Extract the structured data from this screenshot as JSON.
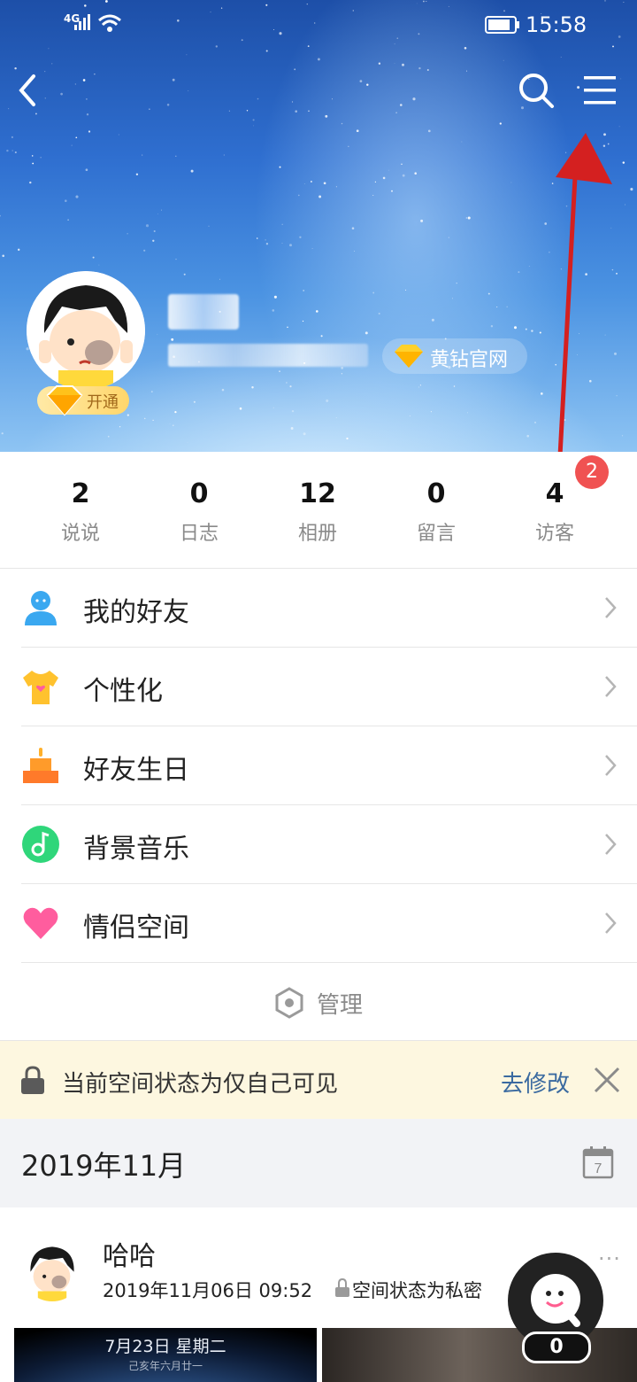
{
  "status_bar": {
    "network": "4G",
    "time": "15:58"
  },
  "profile": {
    "vip_badge": "开通",
    "yellow_diamond": "黄钻官网"
  },
  "stats": [
    {
      "value": "2",
      "label": "说说"
    },
    {
      "value": "0",
      "label": "日志"
    },
    {
      "value": "12",
      "label": "相册"
    },
    {
      "value": "0",
      "label": "留言"
    },
    {
      "value": "4",
      "label": "访客"
    }
  ],
  "visitor_badge": "2",
  "menu": [
    {
      "label": "我的好友",
      "icon": "friends-icon",
      "color": "#3aa8f0"
    },
    {
      "label": "个性化",
      "icon": "tshirt-icon",
      "color": "#ffc22e"
    },
    {
      "label": "好友生日",
      "icon": "birthday-cake-icon",
      "color": "#ff9b2a"
    },
    {
      "label": "背景音乐",
      "icon": "music-note-icon",
      "color": "#2fd67a"
    },
    {
      "label": "情侣空间",
      "icon": "heart-icon",
      "color": "#ff5d9e"
    }
  ],
  "manage": "管理",
  "notice": {
    "text": "当前空间状态为仅自己可见",
    "action": "去修改"
  },
  "month": "2019年11月",
  "calendar_day": "7",
  "post": {
    "author": "哈哈",
    "time": "2019年11月06日 09:52",
    "privacy": "空间状态为私密",
    "more": "···",
    "photo_date": "7月23日 星期二",
    "photo_lunar": "己亥年六月廿一"
  },
  "fab_count": "0",
  "colors": {
    "accent_link": "#3a6aa0",
    "badge_red": "#f05252",
    "notice_bg": "#fdf7e0"
  }
}
